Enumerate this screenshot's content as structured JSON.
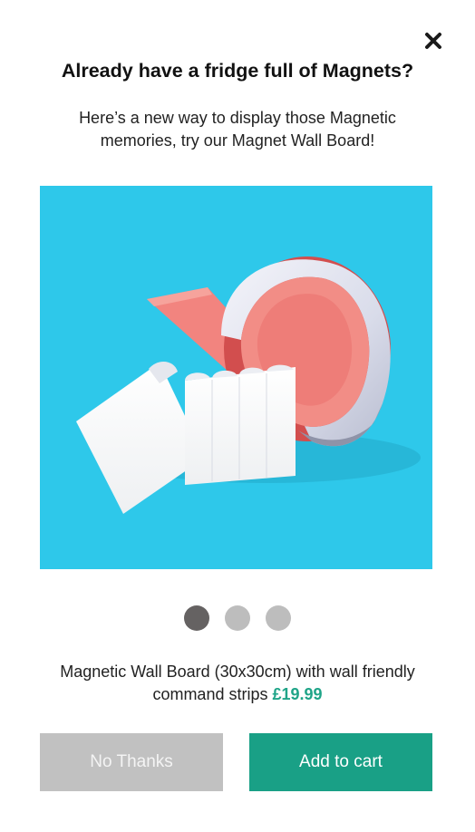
{
  "modal": {
    "title": "Already have a fridge full of Magnets?",
    "subtitle": "Here’s a new way to display those Magnetic memories, try our Magnet Wall Board!",
    "close_icon": "close-icon",
    "image_alt": "Magnetic tape roll with command strips"
  },
  "carousel": {
    "slides": 3,
    "active_index": 0
  },
  "product": {
    "description": "Magnetic Wall Board (30x30cm) with wall friendly command strips",
    "price": "£19.99"
  },
  "actions": {
    "no_thanks_label": "No Thanks",
    "add_to_cart_label": "Add to cart"
  },
  "colors": {
    "accent": "#19a086",
    "price": "#1fa488",
    "hero_background": "#2ec8ea",
    "secondary_button": "#c1c1c1",
    "dot_active": "#656262",
    "dot_inactive": "#bdbdbd"
  }
}
